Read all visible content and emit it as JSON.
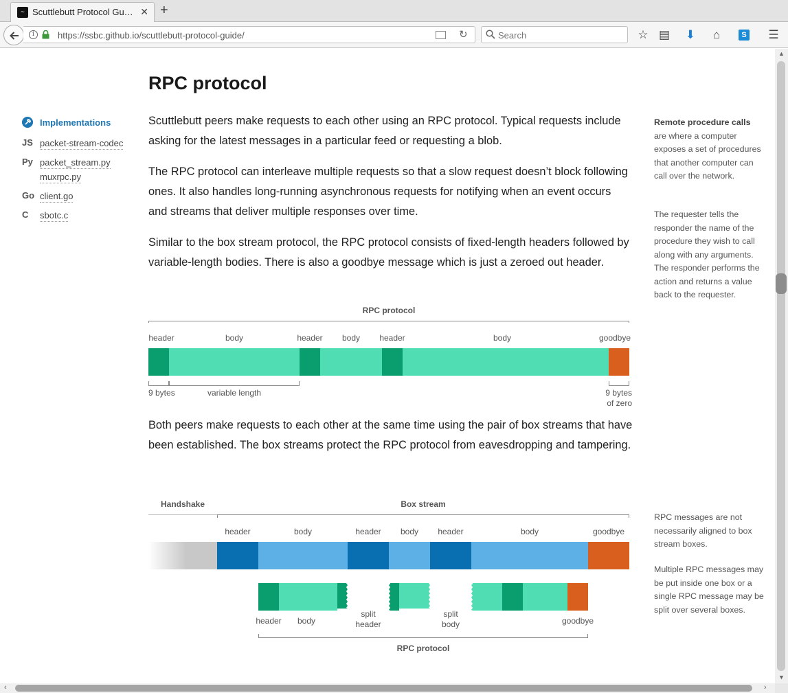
{
  "browser": {
    "tab_title": "Scuttlebutt Protocol Gu…",
    "url": "https://ssbc.github.io/scuttlebutt-protocol-guide/",
    "search_placeholder": "Search"
  },
  "sidebar": {
    "heading": "Implementations",
    "items": [
      {
        "lang": "JS",
        "links": [
          "packet-stream-codec"
        ]
      },
      {
        "lang": "Py",
        "links": [
          "packet_stream.py",
          "muxrpc.py"
        ]
      },
      {
        "lang": "Go",
        "links": [
          "client.go"
        ]
      },
      {
        "lang": "C",
        "links": [
          "sbotc.c"
        ]
      }
    ]
  },
  "article": {
    "title": "RPC protocol",
    "paragraphs": [
      "Scuttlebutt peers make requests to each other using an RPC protocol. Typical requests include asking for the latest messages in a particular feed or requesting a blob.",
      "The RPC protocol can interleave multiple requests so that a slow request doesn’t block following ones. It also handles long-running asynchronous requests for notifying when an event occurs and streams that deliver multiple responses over time.",
      "Similar to the box stream protocol, the RPC protocol consists of fixed-length headers followed by variable-length bodies. There is also a goodbye message which is just a zeroed out header.",
      "Both peers make requests to each other at the same time using the pair of box streams that have been established. The box streams protect the RPC protocol from eavesdropping and tampering."
    ]
  },
  "notes": {
    "rpc_term": "Remote procedure calls",
    "rpc_def": "are where a computer exposes a set of procedures that another computer can call over the network.",
    "requester": "The requester tells the responder the name of the procedure they wish to call along with any arguments. The responder performs the action and returns a value back to the requester.",
    "alignment": "RPC messages are not necessarily aligned to box stream boxes.",
    "multiple": "Multiple RPC messages may be put inside one box or a single RPC message may be split over several boxes."
  },
  "diagram1": {
    "title": "RPC protocol",
    "segment_labels": [
      "header",
      "body",
      "header",
      "body",
      "header",
      "body",
      "goodbye"
    ],
    "header_size": "9 bytes",
    "body_size": "variable length",
    "goodbye_size_line1": "9 bytes",
    "goodbye_size_line2": "of zero",
    "colors": {
      "header": "#0a9e6e",
      "body": "#50ddb3",
      "goodbye": "#d95f1e"
    }
  },
  "diagram2": {
    "handshake_label": "Handshake",
    "box_stream_label": "Box stream",
    "box_labels": [
      "header",
      "body",
      "header",
      "body",
      "header",
      "body",
      "goodbye"
    ],
    "rpc_labels": {
      "header": "header",
      "body": "body",
      "split_header_1": "split",
      "split_header_2": "header",
      "split_body_1": "split",
      "split_body_2": "body",
      "goodbye": "goodbye"
    },
    "rpc_title": "RPC protocol",
    "colors": {
      "box_header": "#0a6fb0",
      "box_body": "#5cb0e6",
      "handshake": "#c8c8c8"
    }
  }
}
